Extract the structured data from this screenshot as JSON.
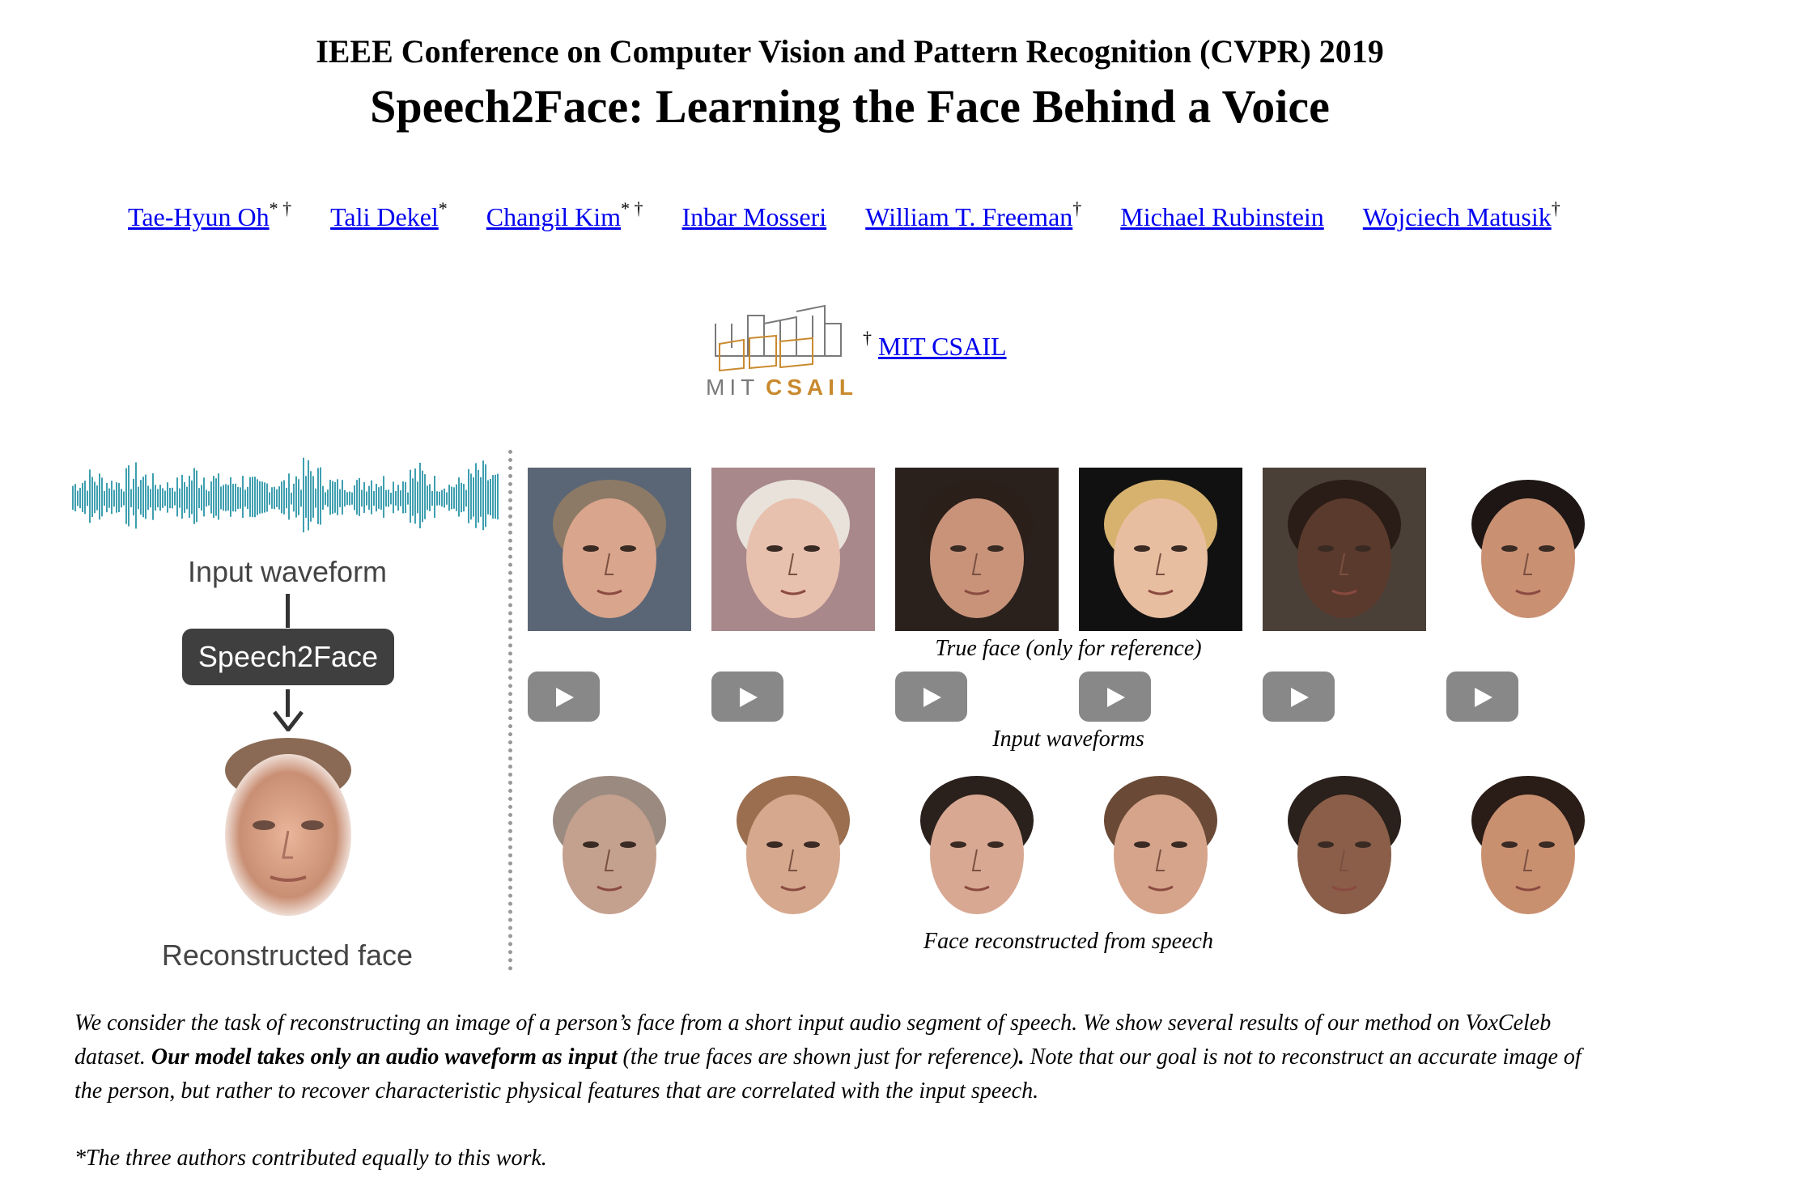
{
  "header": {
    "conference": "IEEE Conference on Computer Vision and Pattern Recognition (CVPR) 2019",
    "title": "Speech2Face: Learning the Face Behind a Voice"
  },
  "authors": [
    {
      "name": "Tae-Hyun Oh",
      "marks": "* †"
    },
    {
      "name": "Tali Dekel",
      "marks": "*"
    },
    {
      "name": "Changil Kim",
      "marks": "* †"
    },
    {
      "name": "Inbar Mosseri",
      "marks": ""
    },
    {
      "name": "William T. Freeman",
      "marks": "†"
    },
    {
      "name": "Michael Rubinstein",
      "marks": ""
    },
    {
      "name": "Wojciech Matusik",
      "marks": "†"
    }
  ],
  "affiliation": {
    "mark": "†",
    "name": "MIT CSAIL",
    "logo_text_left": "MIT",
    "logo_text_right": "CSAIL"
  },
  "diagram": {
    "input_label": "Input waveform",
    "model_label": "Speech2Face",
    "output_label": "Reconstructed face"
  },
  "results": {
    "true_face_caption": "True face (only for reference)",
    "waveforms_caption": "Input waveforms",
    "reconstructed_caption": "Face reconstructed from speech",
    "play_icon": "play-icon",
    "count": 6
  },
  "abstract": {
    "part1": "We consider the task of reconstructing an image of a person’s face from a short input audio segment of speech. We show several results of our method on VoxCeleb dataset. ",
    "bold": "Our model takes only an audio waveform as input",
    "part2": " (the true faces are shown just for reference)",
    "bold_period": ".",
    "part3": " Note that our goal is not to reconstruct an accurate image of the person, but rather to recover characteristic physical features that are correlated with the input speech."
  },
  "footnote": "*The three authors contributed equally to this work.",
  "colors": {
    "link": "#0000ee",
    "logo_gray": "#7a7a7a",
    "logo_orange": "#c98a2e",
    "waveform": "#3f9fb0",
    "play_button": "#888888",
    "model_box": "#3f3f3f"
  }
}
